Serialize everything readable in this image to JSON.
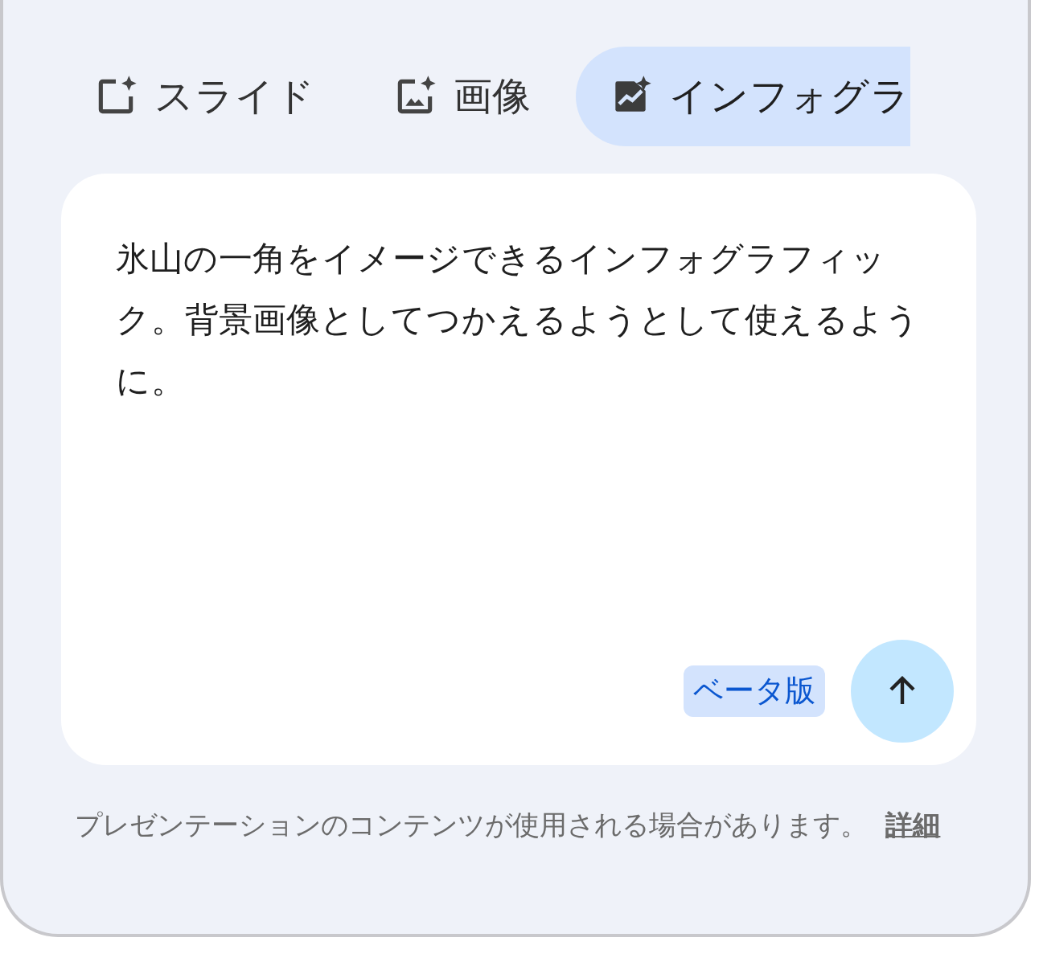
{
  "tabs": [
    {
      "label": "スライド",
      "kind": "slide",
      "selected": false
    },
    {
      "label": "画像",
      "kind": "image",
      "selected": false
    },
    {
      "label": "インフォグラ",
      "kind": "infographic",
      "selected": true
    }
  ],
  "prompt": {
    "value": "氷山の一角をイメージできるインフォグラフィック。背景画像としてつかえるようとして使えるように。"
  },
  "badge": "ベータ版",
  "footer": {
    "note": "プレゼンテーションのコンテンツが使用される場合があります。",
    "link": "詳細"
  }
}
